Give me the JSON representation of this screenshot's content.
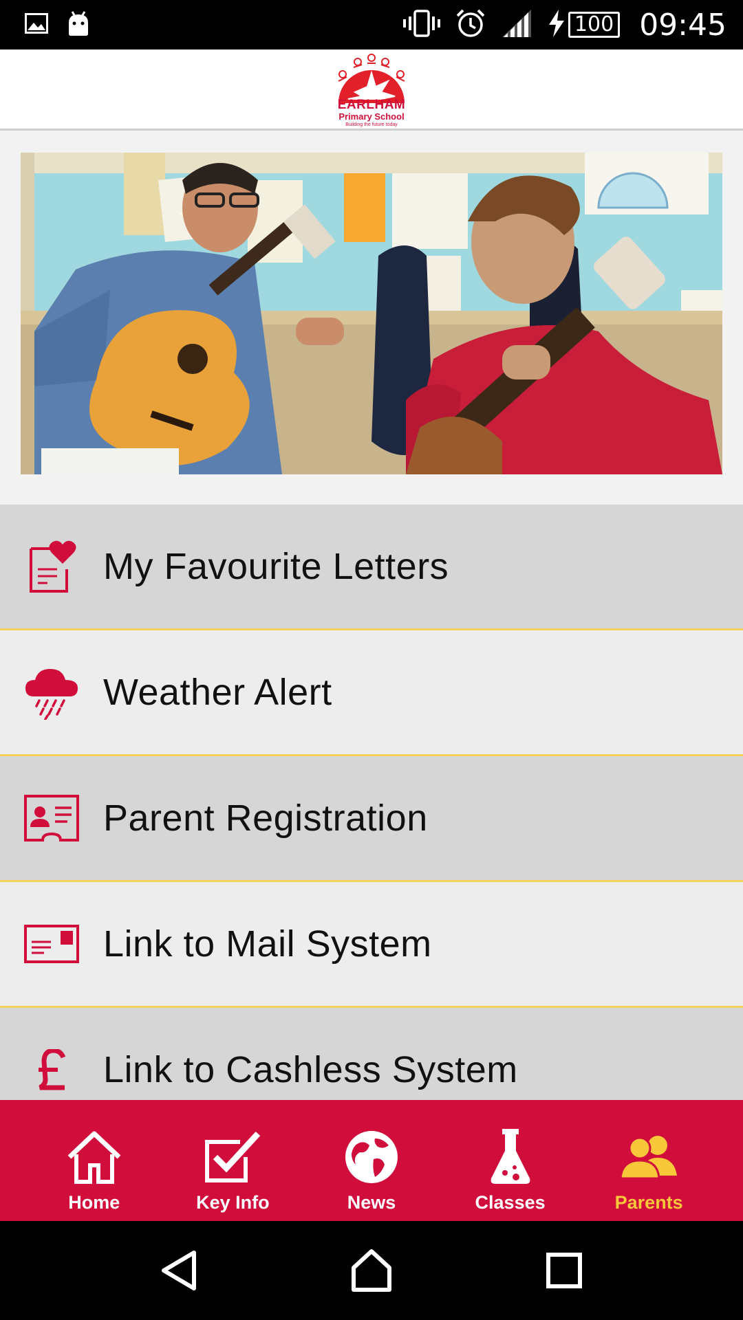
{
  "status_bar": {
    "time": "09:45",
    "battery": "100",
    "icons": [
      "image-icon",
      "android-icon",
      "vibrate-icon",
      "alarm-icon",
      "signal-icon",
      "charging-icon",
      "battery-icon"
    ]
  },
  "header": {
    "logo": {
      "name": "EARLHAM",
      "subtitle": "Primary School",
      "tagline": "Building the future today"
    }
  },
  "hero": {
    "description_icon": "hero-photo"
  },
  "menu": {
    "items": [
      {
        "label": "My Favourite Letters",
        "icon": "letter-heart-icon"
      },
      {
        "label": "Weather Alert",
        "icon": "rain-cloud-icon"
      },
      {
        "label": "Parent Registration",
        "icon": "id-card-icon"
      },
      {
        "label": "Link to Mail System",
        "icon": "postcard-icon"
      },
      {
        "label": "Link to Cashless System",
        "icon": "pound-icon"
      }
    ]
  },
  "tabs": [
    {
      "label": "Home",
      "icon": "home-icon",
      "active": false
    },
    {
      "label": "Key Info",
      "icon": "checkbox-icon",
      "active": false
    },
    {
      "label": "News",
      "icon": "globe-icon",
      "active": false
    },
    {
      "label": "Classes",
      "icon": "flask-icon",
      "active": false
    },
    {
      "label": "Parents",
      "icon": "people-icon",
      "active": true
    }
  ],
  "colors": {
    "brand_red": "#d10d3c",
    "active_tab": "#f8c73a",
    "divider": "#f3d15a"
  },
  "nav_bar": {
    "buttons": [
      "back-icon",
      "home-nav-icon",
      "recents-icon"
    ]
  }
}
